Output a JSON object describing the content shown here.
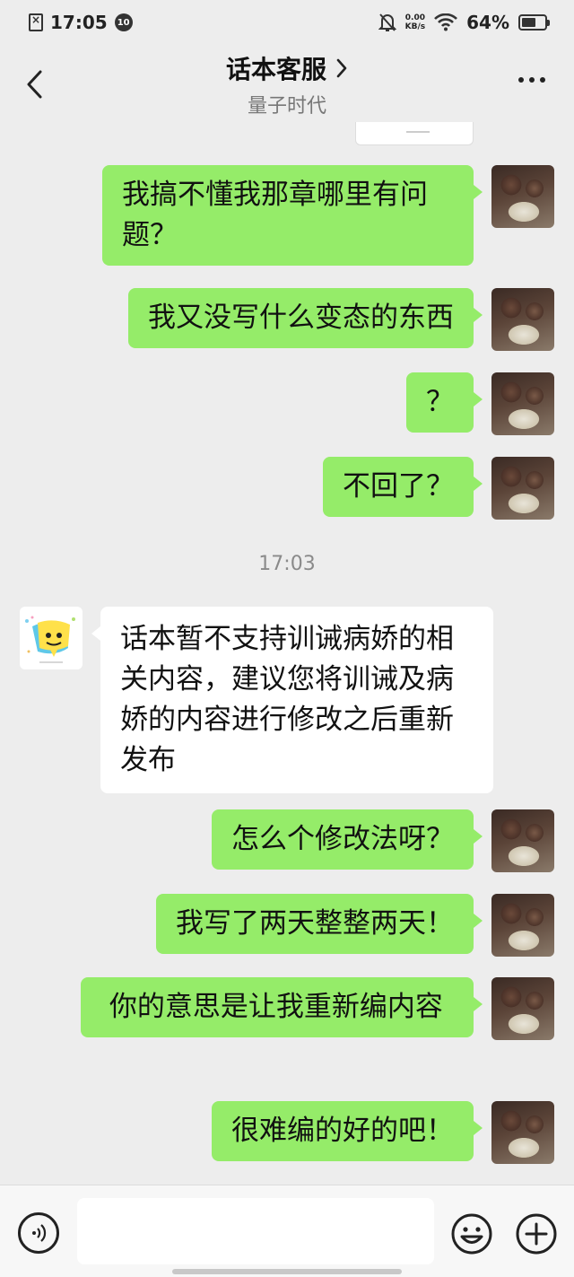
{
  "status_bar": {
    "time": "17:05",
    "notification_count": "10",
    "net_speed_value": "0.00",
    "net_speed_unit": "KB/s",
    "battery": "64%",
    "battery_level": 0.64
  },
  "header": {
    "title": "话本客服",
    "subtitle": "量子时代"
  },
  "messages": [
    {
      "side": "right",
      "text": "我搞不懂我那章哪里有问题？"
    },
    {
      "side": "right",
      "text": "我又没写什么变态的东西"
    },
    {
      "side": "right",
      "text": "？"
    },
    {
      "side": "right",
      "text": "不回了？"
    },
    {
      "side": "time",
      "text": "17:03"
    },
    {
      "side": "left",
      "text": "话本暂不支持训诫病娇的相关内容，建议您将训诫及病娇的内容进行修改之后重新发布"
    },
    {
      "side": "right",
      "text": "怎么个修改法呀？"
    },
    {
      "side": "right",
      "text": "我写了两天整整两天！"
    },
    {
      "side": "right",
      "text": " 你的意思是让我重新编内容"
    },
    {
      "side": "right",
      "text": "很难编的好的吧！"
    }
  ],
  "input": {
    "value": "",
    "placeholder": ""
  },
  "icons": {
    "back": "chevron-left-icon",
    "title_arrow": "chevron-right-icon",
    "more": "more-dots-icon",
    "voice": "voice-icon",
    "emoji": "emoji-icon",
    "plus": "plus-icon"
  },
  "colors": {
    "background": "#ededed",
    "sent_bubble": "#95ec69",
    "received_bubble": "#ffffff",
    "input_bar": "#f7f7f7",
    "timestamp_text": "#8a8a8a",
    "subtitle_text": "#777777"
  }
}
